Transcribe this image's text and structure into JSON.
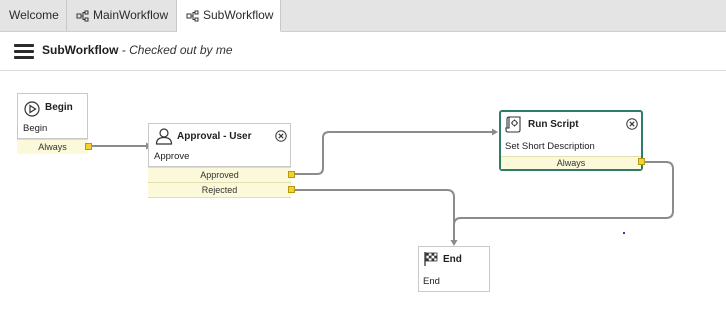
{
  "tabs": [
    {
      "label": "Welcome",
      "active": false,
      "icon": null
    },
    {
      "label": "MainWorkflow",
      "active": false,
      "icon": "workflow-icon"
    },
    {
      "label": "SubWorkflow",
      "active": true,
      "icon": "workflow-icon"
    }
  ],
  "header": {
    "menu_icon": "hamburger-menu-icon",
    "workflow_name": "SubWorkflow",
    "status": " - Checked out by me"
  },
  "activities": {
    "begin": {
      "title": "Begin",
      "subtitle": "Begin",
      "icon": "play-icon",
      "exits": [
        "Always"
      ]
    },
    "approval": {
      "title": "Approval - User",
      "subtitle": "Approve",
      "icon": "user-icon",
      "exits": [
        "Approved",
        "Rejected"
      ]
    },
    "run_script": {
      "title": "Run Script",
      "subtitle": "Set Short Description",
      "icon": "script-icon",
      "exits": [
        "Always"
      ]
    },
    "end": {
      "title": "End",
      "subtitle": "End",
      "icon": "checkered-flag-icon",
      "exits": []
    }
  },
  "colors": {
    "selected_border": "#2e7d6b",
    "exit_background": "#fbf9d9",
    "port": "#f2d233",
    "connector": "#8c8c8c"
  }
}
